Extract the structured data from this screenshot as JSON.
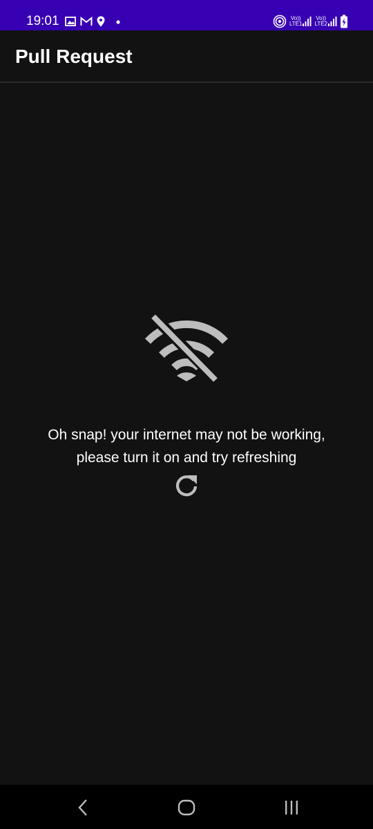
{
  "status_bar": {
    "time": "19:01",
    "left_icons": [
      "gallery-icon",
      "gmail-icon",
      "location-icon",
      "dot-icon"
    ],
    "right_icons": [
      "hotspot-icon",
      "volte-lte1-signal-icon",
      "volte-lte2-signal-icon",
      "battery-charging-icon"
    ],
    "sim1_top": "Vo))",
    "sim1_bottom": "LTE1",
    "sim2_top": "Vo))",
    "sim2_bottom": "LTE2",
    "color": "#3700b3"
  },
  "app_bar": {
    "title": "Pull Request"
  },
  "main": {
    "icon": "wifi-off-icon",
    "message_line1": "Oh snap! your internet may not be working,",
    "message_line2": "please turn it on and try refreshing",
    "refresh_icon": "refresh-icon",
    "icon_color": "#bdbdbd"
  },
  "nav_bar": {
    "buttons": [
      "back-icon",
      "home-icon",
      "recents-icon"
    ]
  }
}
